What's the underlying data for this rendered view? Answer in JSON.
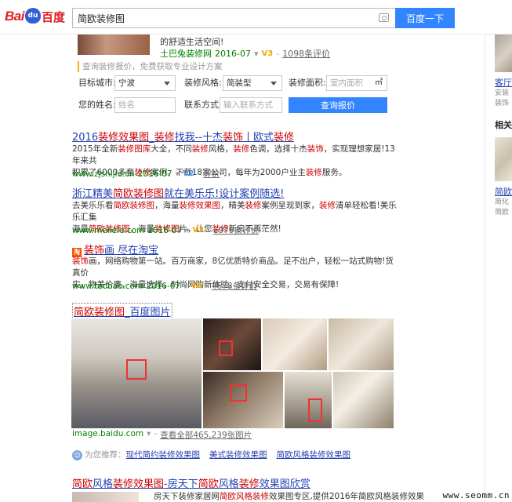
{
  "header": {
    "logo_latin": "Bai",
    "logo_paw": "du",
    "logo_cn": "百度",
    "search_value": "简欧装修图",
    "search_button": "百度一下"
  },
  "ad": {
    "line1": "的舒适生活空间!",
    "source": "土巴兔装修网",
    "date": "2016-07",
    "level": "V3",
    "reviews": "1098条评价",
    "note": "查询装修报价，免费获取专业设计方案",
    "form": {
      "city_label": "目标城市:",
      "city_value": "宁波",
      "style_label": "装修风格:",
      "style_value": "简装型",
      "area_label": "装修面积:",
      "area_placeholder": "室内面积",
      "area_unit": "㎡",
      "name_label": "您的姓名:",
      "name_placeholder": "姓名",
      "contact_label": "联系方式:",
      "contact_placeholder": "输入联系方式",
      "submit": "查询报价"
    }
  },
  "results": [
    {
      "title_parts": [
        "2016",
        "装修效果图",
        "_",
        "装修",
        "找我--十杰",
        "装饰",
        "丨欧式",
        "装修"
      ],
      "abstract_lines": [
        [
          "2015年全新",
          "装修图库",
          "大全，不同",
          "装修",
          "风格，",
          "装修",
          "色调，选择十杰",
          "装饰",
          "，实现理想家居!13年来共"
        ],
        [
          "积累了6000多套",
          "装修",
          "案例。下载18家公司，每年为2000户业主",
          "装修",
          "服务。"
        ]
      ],
      "url": "www.zjshijie.cn",
      "date": "2016-07",
      "level": "V2",
      "reviews": "评价"
    },
    {
      "title_parts": [
        "浙江精美",
        "简欧装修图",
        "就在美乐乐!设计案例随选!"
      ],
      "abstract_lines": [
        [
          "去美乐乐看",
          "简欧装修图",
          "，海量",
          "装修效果图",
          "，精美",
          "装修",
          "案例呈现到家，",
          "装修",
          "清单轻松看!美乐乐汇集"
        ],
        [
          "海量",
          "简欧装修图",
          "，海量",
          "装修图",
          "片，让您",
          "装修",
          "新房不再茫然!"
        ]
      ],
      "url": "www.meilele.com",
      "date": "2016-07",
      "level": "V3",
      "reviews": "1979条评价"
    },
    {
      "icon": "淘",
      "title_parts": [
        "装饰",
        "画 尽在淘宝"
      ],
      "abstract_lines": [
        [
          "装饰",
          "画，网络购物第一站。百万商家，8亿优质特价商品。足不出户，轻松一站式购物!货真价"
        ],
        [
          "实，物美价廉，海量选择，时尚网购新体验。支付安全交易，交易有保障!"
        ]
      ],
      "url": "www.taobao.com",
      "date": "2016-07",
      "level": "V3",
      "reviews": "4678条评价"
    }
  ],
  "image_block": {
    "title_parts": [
      "简欧装修图",
      "_百度图片"
    ],
    "url": "image.baidu.com",
    "view_all": "查看全部465,239张图片"
  },
  "recommend": {
    "prefix": "为您推荐：",
    "links": [
      "现代简约装修效果图",
      "美式装修效果图",
      "简欧风格装修效果图"
    ]
  },
  "last_result": {
    "title_parts": [
      "简欧",
      "风格",
      "装修效果图",
      "-房天下",
      "简欧",
      "风格",
      "装修",
      "效果图欣赏"
    ],
    "abstract": [
      "房天下装修家居网",
      "简欧风格",
      "装修",
      "效果图专区,提供2016年简欧风格装修效果"
    ]
  },
  "right_col": {
    "link1": "客厅",
    "gray1": "安装",
    "gray2": "装饰",
    "heading": "相关",
    "link2": "简欧",
    "gray3": "简化",
    "gray4": "简欧"
  },
  "watermark": "www.seomm.cn"
}
